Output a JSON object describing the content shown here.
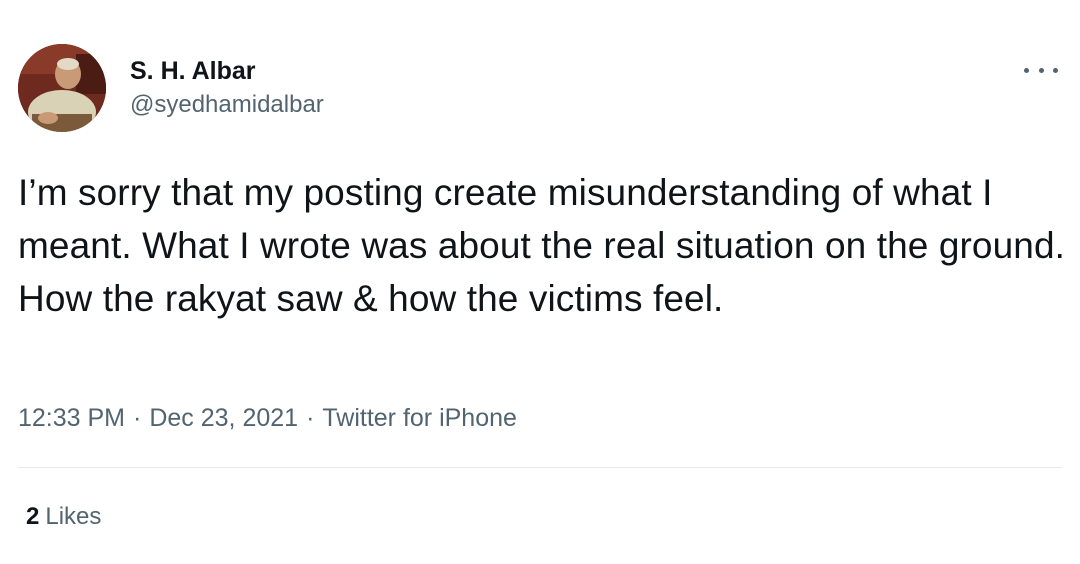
{
  "author": {
    "display_name": "S. H. Albar",
    "handle": "@syedhamidalbar",
    "avatar_icon": "profile-photo"
  },
  "menu": {
    "icon": "more-dots-icon"
  },
  "tweet": {
    "text": "I’m sorry that my posting create misunderstanding of what I meant. What I wrote was about the real situation on the ground. How the rakyat saw & how the victims feel.",
    "time": "12:33 PM",
    "date": "Dec 23, 2021",
    "separator": "·",
    "source": "Twitter for iPhone"
  },
  "stats": {
    "likes_count": "2",
    "likes_label": "Likes"
  },
  "colors": {
    "text_primary": "#0f1419",
    "text_secondary": "#536471",
    "divider": "#e6e9ec"
  }
}
